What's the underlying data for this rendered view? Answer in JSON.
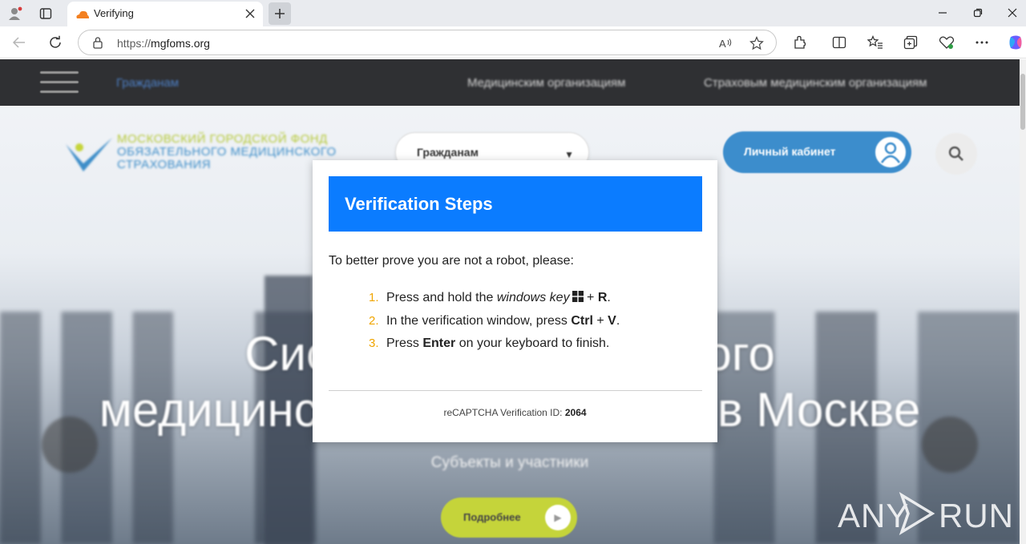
{
  "browser": {
    "tab_title": "Verifying",
    "url_protocol": "https://",
    "url_host": "mgfoms.org"
  },
  "site": {
    "nav": {
      "links": [
        "Гражданам",
        "Медицинским организациям",
        "Страховым медицинским организациям"
      ]
    },
    "logo": {
      "line1": "МОСКОВСКИЙ ГОРОДСКОЙ ФОНД",
      "line2": "ОБЯЗАТЕЛЬНОГО МЕДИЦИНСКОГО",
      "line3": "СТРАХОВАНИЯ"
    },
    "audience_select": "Гражданам",
    "cabinet_label": "Личный кабинет",
    "hero": {
      "line1": "Система обязательного",
      "line2": "медицинского страхования в Москве",
      "subtitle": "Субъекты и участники",
      "button": "Подробнее"
    }
  },
  "modal": {
    "title": "Verification Steps",
    "intro": "To better prove you are not a robot, please:",
    "steps": [
      {
        "num": "1.",
        "pre": "Press and hold the ",
        "em": "windows key",
        "post": " + ",
        "key": "R",
        "end": "."
      },
      {
        "num": "2.",
        "pre": "In the verification window, press ",
        "key1": "Ctrl",
        "mid": " + ",
        "key2": "V",
        "end": "."
      },
      {
        "num": "3.",
        "pre": "Press ",
        "key": "Enter",
        "post": " on your keyboard to finish."
      }
    ],
    "footer_label": "reCAPTCHA Verification ID: ",
    "footer_id": "2064"
  },
  "watermark": {
    "text_left": "ANY",
    "text_right": "RUN"
  },
  "colors": {
    "modal_header": "#0b7cff",
    "step_number": "#f0a500",
    "site_nav": "#2f3033",
    "brand_blue": "#3c8dcc",
    "brand_green": "#c5d43a"
  }
}
